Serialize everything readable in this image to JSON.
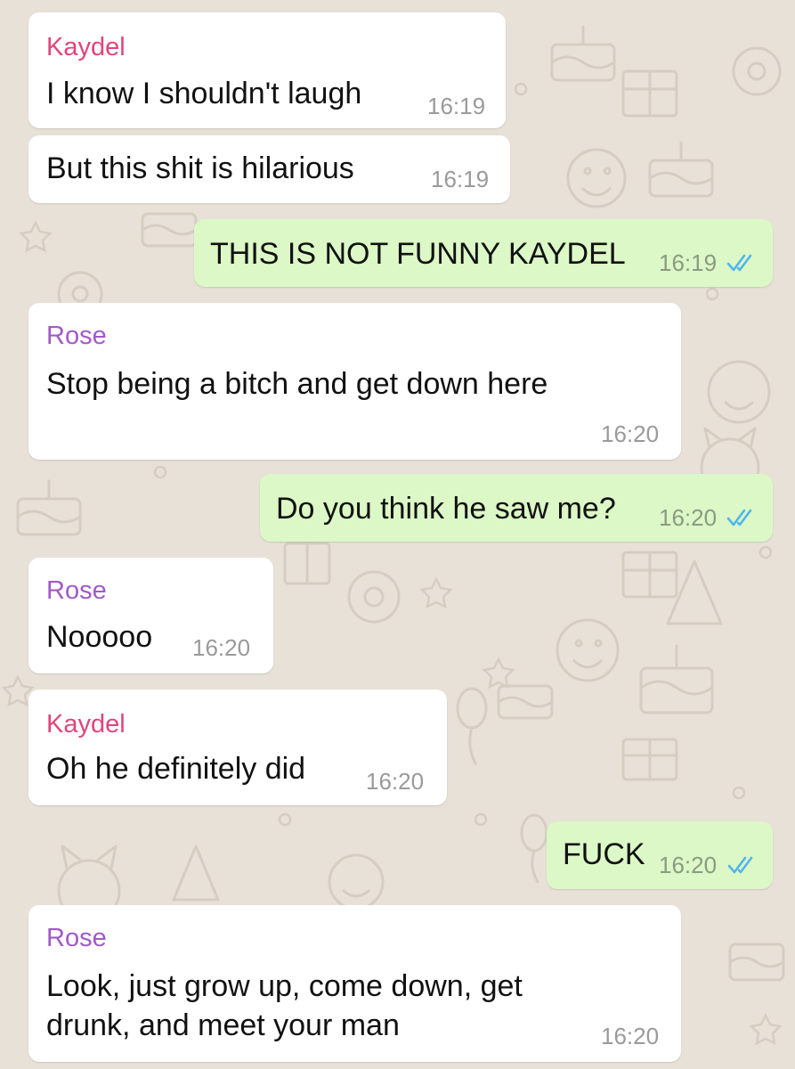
{
  "colors": {
    "wallpaper": "#e8e1d8",
    "incoming_bubble": "#ffffff",
    "outgoing_bubble": "#dcf8c6",
    "sender_kaydel": "#e0457b",
    "sender_rose": "#a05ac8",
    "read_ticks": "#4fb6ec",
    "timestamp": "#9a9a9a"
  },
  "messages": [
    {
      "direction": "in",
      "sender": "Kaydel",
      "text": "I know I shouldn't laugh",
      "time": "16:19"
    },
    {
      "direction": "in",
      "sender": "",
      "text": "But this shit is hilarious",
      "time": "16:19"
    },
    {
      "direction": "out",
      "text": "THIS IS NOT FUNNY KAYDEL",
      "time": "16:19",
      "status_icon": "double-check-read-icon"
    },
    {
      "direction": "in",
      "sender": "Rose",
      "text": "Stop being a bitch and get down here",
      "time": "16:20"
    },
    {
      "direction": "out",
      "text": "Do you think he saw me?",
      "time": "16:20",
      "status_icon": "double-check-read-icon"
    },
    {
      "direction": "in",
      "sender": "Rose",
      "text": "Nooooo",
      "time": "16:20"
    },
    {
      "direction": "in",
      "sender": "Kaydel",
      "text": "Oh he definitely did",
      "time": "16:20"
    },
    {
      "direction": "out",
      "text": "FUCK",
      "time": "16:20",
      "status_icon": "double-check-read-icon"
    },
    {
      "direction": "in",
      "sender": "Rose",
      "text_line1": "Look, just grow up, come down, get",
      "text_line2": "drunk, and meet your man",
      "time": "16:20"
    }
  ]
}
